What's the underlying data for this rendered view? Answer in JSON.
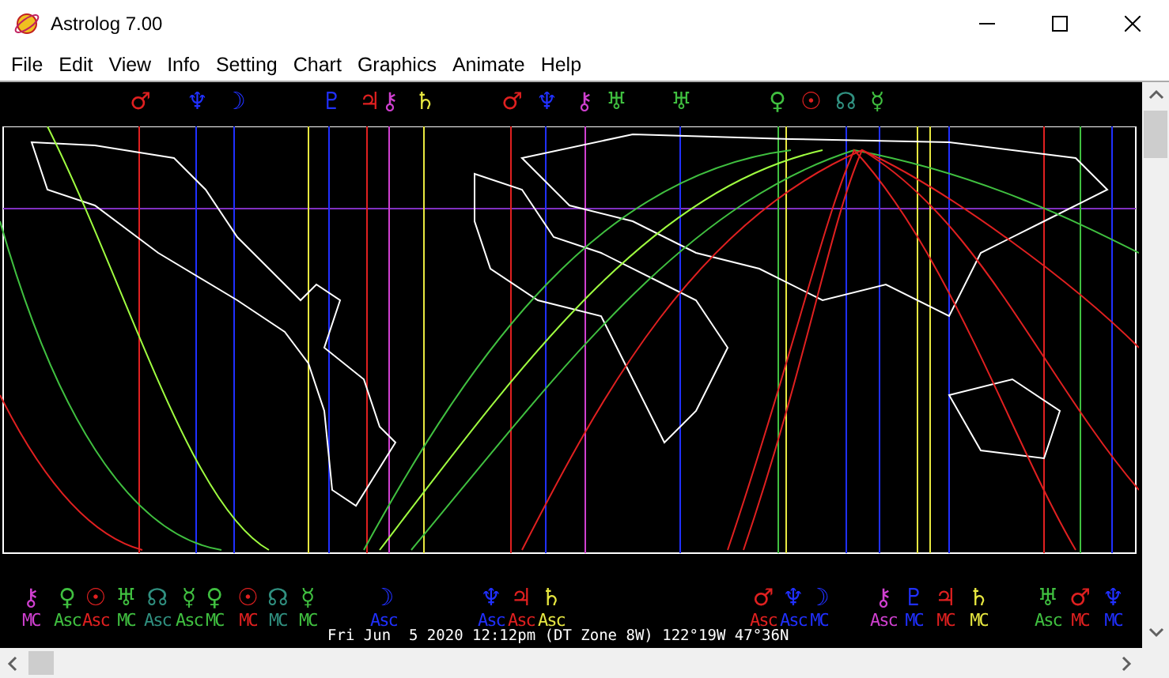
{
  "window": {
    "title": "Astrolog 7.00"
  },
  "menu": [
    "File",
    "Edit",
    "View",
    "Info",
    "Setting",
    "Chart",
    "Graphics",
    "Animate",
    "Help"
  ],
  "top_glyphs": [
    {
      "glyph": "♂",
      "color": "#e02020"
    },
    {
      "glyph": "♆",
      "color": "#2030ff"
    },
    {
      "glyph": "☽",
      "color": "#2030ff"
    },
    {
      "glyph": "♇",
      "color": "#2030ff"
    },
    {
      "glyph": "♃",
      "color": "#e02020"
    },
    {
      "glyph": "⚷",
      "color": "#d040d0"
    },
    {
      "glyph": "♄",
      "color": "#e8e840"
    },
    {
      "glyph": "♂",
      "color": "#e02020"
    },
    {
      "glyph": "♆",
      "color": "#2030ff"
    },
    {
      "glyph": "⚷",
      "color": "#d040d0"
    },
    {
      "glyph": "♅",
      "color": "#40c040"
    },
    {
      "glyph": "♅",
      "color": "#40c040"
    },
    {
      "glyph": "♀",
      "color": "#40c040"
    },
    {
      "glyph": "☉",
      "color": "#e02020"
    },
    {
      "glyph": "☊",
      "color": "#309080"
    },
    {
      "glyph": "☿",
      "color": "#40c040"
    }
  ],
  "bottom_labels": [
    {
      "glyph": "⚷",
      "angle": "MC",
      "color": "#d040d0"
    },
    {
      "glyph": "♀",
      "angle": "Asc",
      "color": "#40c040"
    },
    {
      "glyph": "☉",
      "angle": "Asc",
      "color": "#e02020"
    },
    {
      "glyph": "♅",
      "angle": "MC",
      "color": "#40c040"
    },
    {
      "glyph": "☊",
      "angle": "Asc",
      "color": "#309080"
    },
    {
      "glyph": "☿",
      "angle": "Asc",
      "color": "#40c040"
    },
    {
      "glyph": "♀",
      "angle": "MC",
      "color": "#40c040"
    },
    {
      "glyph": "☉",
      "angle": "MC",
      "color": "#e02020"
    },
    {
      "glyph": "☊",
      "angle": "MC",
      "color": "#309080"
    },
    {
      "glyph": "☿",
      "angle": "MC",
      "color": "#40c040"
    },
    {
      "glyph": "☽",
      "angle": "Asc",
      "color": "#2030ff"
    },
    {
      "glyph": "♆",
      "angle": "Asc",
      "color": "#2030ff"
    },
    {
      "glyph": "♃",
      "angle": "Asc",
      "color": "#e02020"
    },
    {
      "glyph": "♄",
      "angle": "Asc",
      "color": "#e8e840"
    },
    {
      "glyph": "♂",
      "angle": "Asc",
      "color": "#e02020"
    },
    {
      "glyph": "♆",
      "angle": "Asc",
      "color": "#2030ff"
    },
    {
      "glyph": "☽",
      "angle": "MC",
      "color": "#2030ff"
    },
    {
      "glyph": "⚷",
      "angle": "Asc",
      "color": "#d040d0"
    },
    {
      "glyph": "♇",
      "angle": "MC",
      "color": "#2030ff"
    },
    {
      "glyph": "♃",
      "angle": "MC",
      "color": "#e02020"
    },
    {
      "glyph": "♄",
      "angle": "MC",
      "color": "#e8e840"
    },
    {
      "glyph": "♅",
      "angle": "Asc",
      "color": "#40c040"
    },
    {
      "glyph": "♂",
      "angle": "MC",
      "color": "#e02020"
    },
    {
      "glyph": "♆",
      "angle": "MC",
      "color": "#2030ff"
    }
  ],
  "chart_info": "Fri Jun  5 2020 12:12pm (DT Zone 8W) 122°19W 47°36N"
}
